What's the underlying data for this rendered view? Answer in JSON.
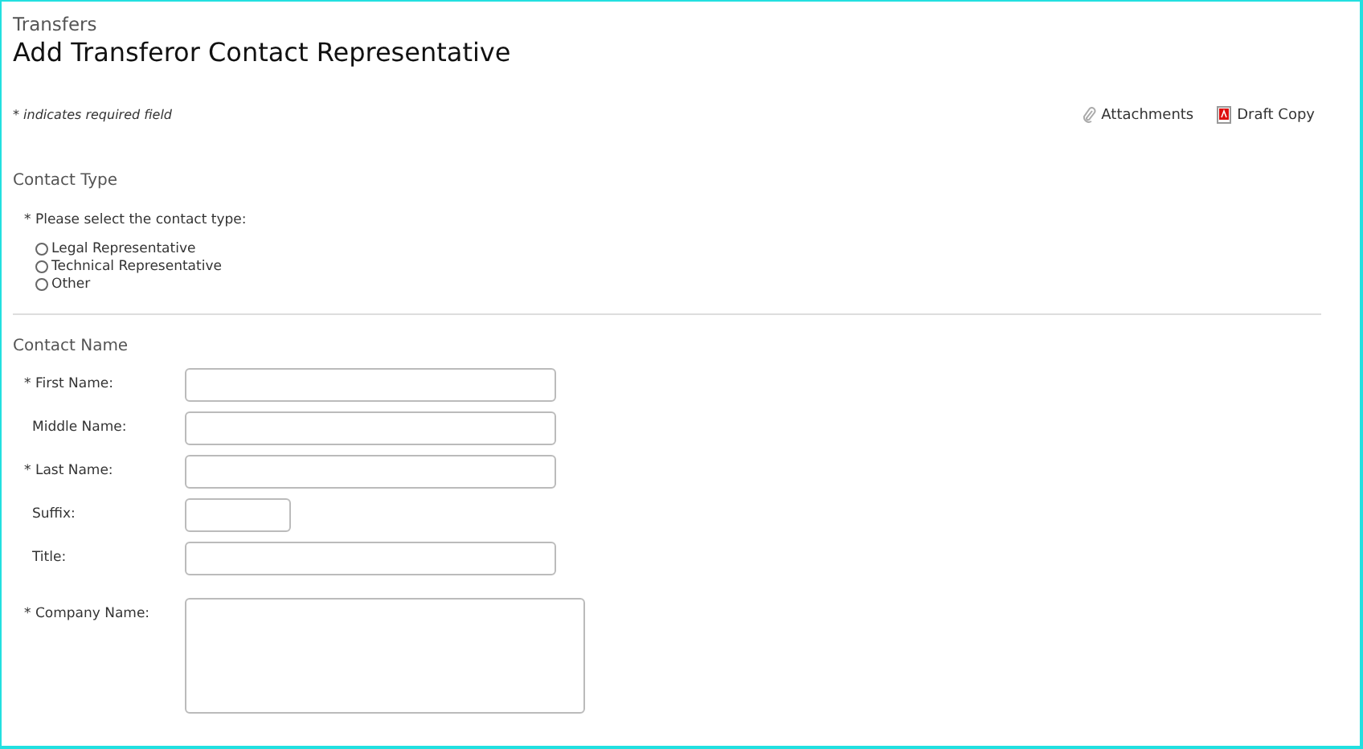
{
  "breadcrumb": "Transfers",
  "title": "Add Transferor Contact Representative",
  "required_note": "* indicates required field",
  "actions": [
    {
      "label": "Attachments",
      "kind": "clip"
    },
    {
      "label": "Draft Copy",
      "kind": "pdf"
    }
  ],
  "contact_type": {
    "heading": "Contact Type",
    "prompt": "* Please select the contact type:",
    "options": [
      {
        "label": "Legal Representative",
        "selected": false
      },
      {
        "label": "Technical Representative",
        "selected": false
      },
      {
        "label": "Other",
        "selected": false
      }
    ]
  },
  "contact_name": {
    "heading": "Contact Name",
    "fields": [
      {
        "label": "* First Name:",
        "kind": "text"
      },
      {
        "label": "Middle Name:",
        "kind": "text"
      },
      {
        "label": "* Last Name:",
        "kind": "text"
      },
      {
        "label": "Suffix:",
        "kind": "short"
      },
      {
        "label": "Title:",
        "kind": "text"
      },
      {
        "label": "* Company Name:",
        "kind": "textarea"
      }
    ]
  }
}
